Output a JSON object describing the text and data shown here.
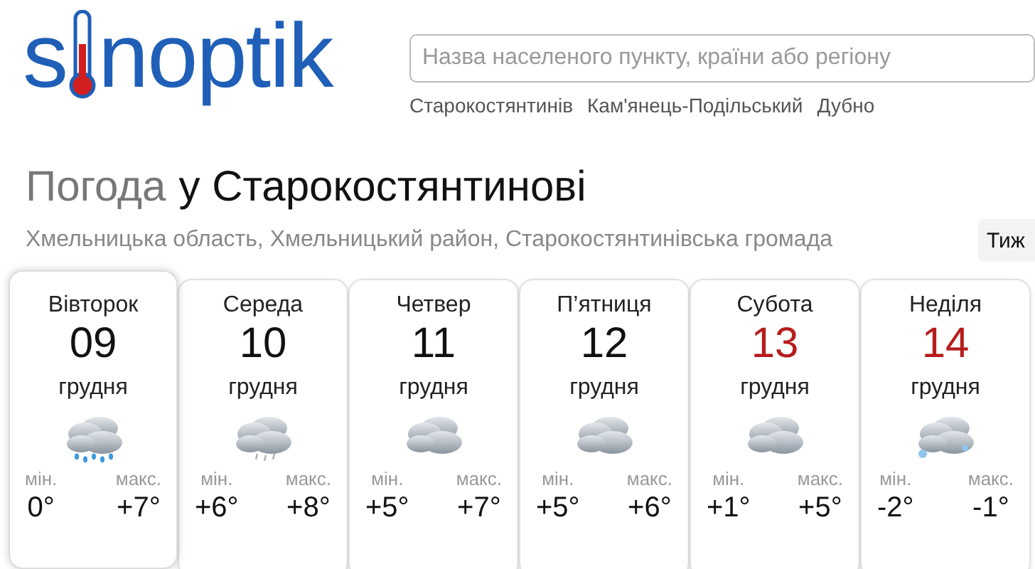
{
  "logo": {
    "before": "s",
    "after": "noptik"
  },
  "search": {
    "placeholder": "Назва населеного пункту, країни або регіону"
  },
  "recent_places": [
    "Старокостянтинів",
    "Кам'янець-Подільський",
    "Дубно"
  ],
  "heading": {
    "prefix": "Погода",
    "place": "у Старокостянтинові"
  },
  "region": "Хмельницька область, Хмельницький район, Старокостянтинівська громада",
  "period_button": "Тиж",
  "days": [
    {
      "weekday": "Вівторок",
      "date": "09",
      "month": "грудня",
      "weekend": false,
      "selected": true,
      "kind": "rain",
      "min_label": "мін.",
      "min": "0°",
      "max_label": "макс.",
      "max": "+7°"
    },
    {
      "weekday": "Середа",
      "date": "10",
      "month": "грудня",
      "weekend": false,
      "selected": false,
      "kind": "light_rain",
      "min_label": "мін.",
      "min": "+6°",
      "max_label": "макс.",
      "max": "+8°"
    },
    {
      "weekday": "Четвер",
      "date": "11",
      "month": "грудня",
      "weekend": false,
      "selected": false,
      "kind": "cloudy",
      "min_label": "мін.",
      "min": "+5°",
      "max_label": "макс.",
      "max": "+7°"
    },
    {
      "weekday": "П’ятниця",
      "date": "12",
      "month": "грудня",
      "weekend": false,
      "selected": false,
      "kind": "cloudy",
      "min_label": "мін.",
      "min": "+5°",
      "max_label": "макс.",
      "max": "+6°"
    },
    {
      "weekday": "Субота",
      "date": "13",
      "month": "грудня",
      "weekend": true,
      "selected": false,
      "kind": "cloudy",
      "min_label": "мін.",
      "min": "+1°",
      "max_label": "макс.",
      "max": "+5°"
    },
    {
      "weekday": "Неділя",
      "date": "14",
      "month": "грудня",
      "weekend": true,
      "selected": false,
      "kind": "snow",
      "min_label": "мін.",
      "min": "-2°",
      "max_label": "макс.",
      "max": "-1°"
    }
  ]
}
